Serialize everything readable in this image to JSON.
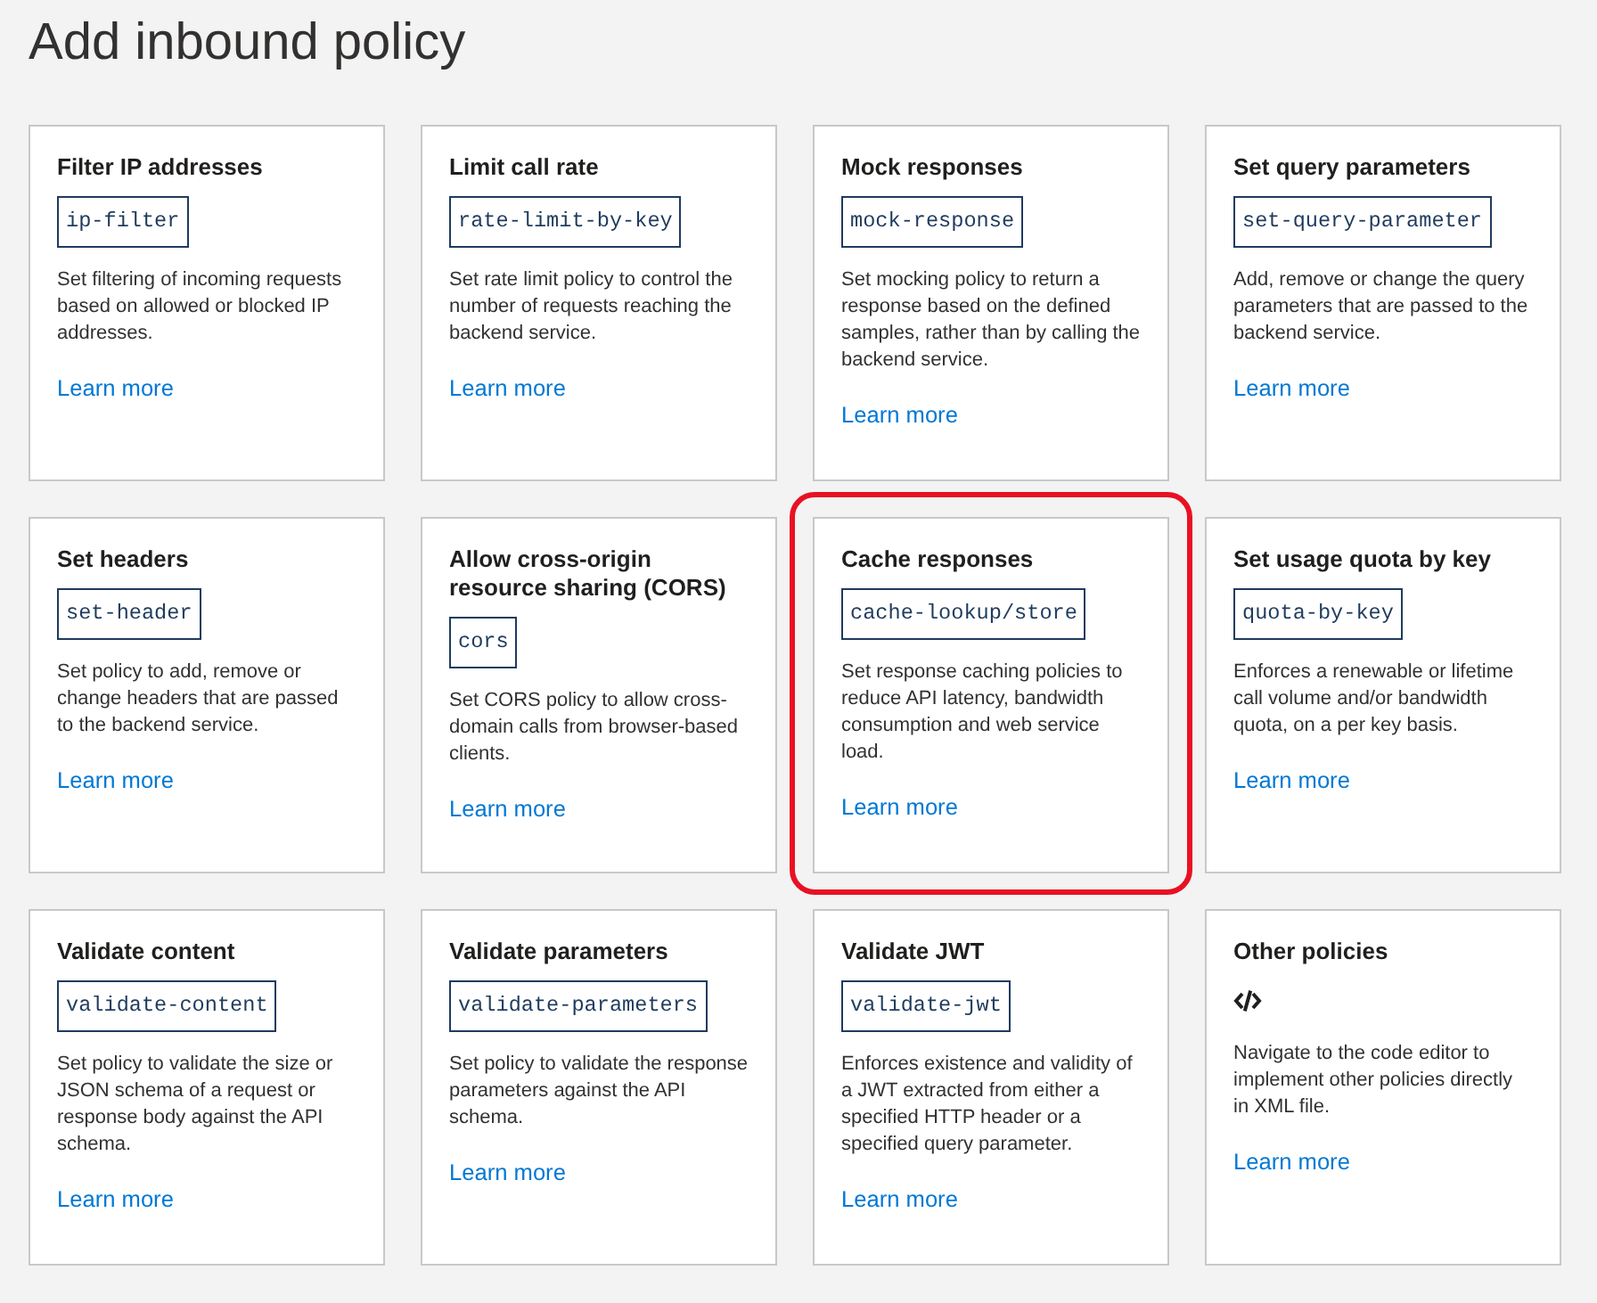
{
  "page": {
    "title": "Add inbound policy"
  },
  "cards": [
    {
      "kind": "policy",
      "title": "Filter IP addresses",
      "code": "ip-filter",
      "description": "Set filtering of incoming requests based on allowed or blocked IP addresses.",
      "link": "Learn more",
      "highlighted": false
    },
    {
      "kind": "policy",
      "title": "Limit call rate",
      "code": "rate-limit-by-key",
      "description": "Set rate limit policy to control the number of requests reaching the backend service.",
      "link": "Learn more",
      "highlighted": false
    },
    {
      "kind": "policy",
      "title": "Mock responses",
      "code": "mock-response",
      "description": "Set mocking policy to return a response based on the defined samples, rather than by calling the backend service.",
      "link": "Learn more",
      "highlighted": false
    },
    {
      "kind": "policy",
      "title": "Set query parameters",
      "code": "set-query-parameter",
      "description": "Add, remove or change the query parameters that are passed to the backend service.",
      "link": "Learn more",
      "highlighted": false
    },
    {
      "kind": "policy",
      "title": "Set headers",
      "code": "set-header",
      "description": "Set policy to add, remove or change headers that are passed to the backend service.",
      "link": "Learn more",
      "highlighted": false
    },
    {
      "kind": "policy",
      "title": "Allow cross-origin resource sharing (CORS)",
      "code": "cors",
      "description": "Set CORS policy to allow cross-domain calls from browser-based clients.",
      "link": "Learn more",
      "highlighted": false
    },
    {
      "kind": "policy",
      "title": "Cache responses",
      "code": "cache-lookup/store",
      "description": "Set response caching policies to reduce API latency, bandwidth consumption and web service load.",
      "link": "Learn more",
      "highlighted": true
    },
    {
      "kind": "policy",
      "title": "Set usage quota by key",
      "code": "quota-by-key",
      "description": "Enforces a renewable or lifetime call volume and/or bandwidth quota, on a per key basis.",
      "link": "Learn more",
      "highlighted": false
    },
    {
      "kind": "policy",
      "title": "Validate content",
      "code": "validate-content",
      "description": "Set policy to validate the size or JSON schema of a request or response body against the API schema.",
      "link": "Learn more",
      "highlighted": false
    },
    {
      "kind": "policy",
      "title": "Validate parameters",
      "code": "validate-parameters",
      "description": "Set policy to validate the response parameters against the API schema.",
      "link": "Learn more",
      "highlighted": false
    },
    {
      "kind": "policy",
      "title": "Validate JWT",
      "code": "validate-jwt",
      "description": "Enforces existence and validity of a JWT extracted from either a specified HTTP header or a specified query parameter.",
      "link": "Learn more",
      "highlighted": false
    },
    {
      "kind": "editor",
      "title": "Other policies",
      "description": "Navigate to the code editor to implement other policies directly in XML file.",
      "link": "Learn more",
      "highlighted": false
    }
  ]
}
